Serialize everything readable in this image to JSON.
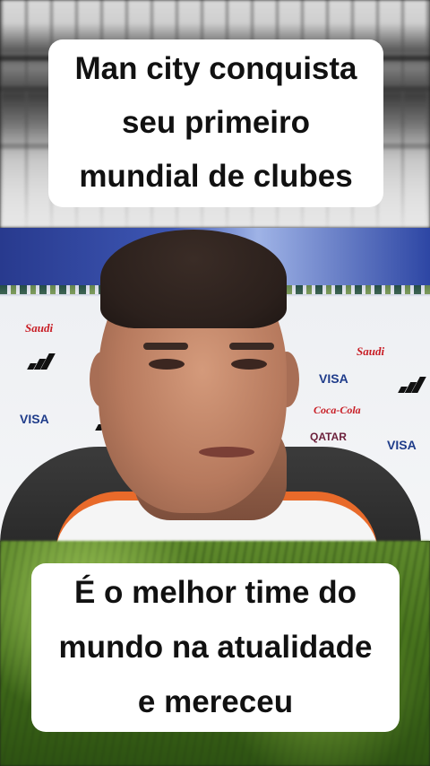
{
  "captions": {
    "top_lines": [
      "Man city conquista",
      "seu primeiro",
      "mundial de clubes"
    ],
    "bottom_lines": [
      "É o melhor time do",
      "mundo na atualidade",
      "e mereceu"
    ]
  },
  "backdrop": {
    "sponsors": [
      "VISA",
      "VISA",
      "VISA",
      "VISA",
      "Coca-Cola",
      "QATAR"
    ]
  },
  "colors": {
    "caption_bg": "#ffffff",
    "caption_text": "#111111",
    "shirt_accent": "#e86a2a",
    "banner_blue": "#2c3e8c"
  }
}
